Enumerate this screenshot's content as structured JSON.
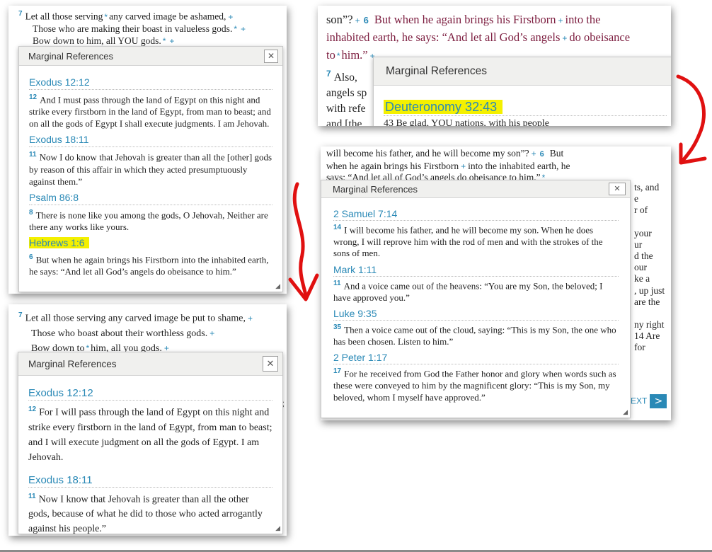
{
  "shot1": {
    "verse7_num": "7",
    "verse7_l1": "Let all those serving",
    "verse7_l1b": "any carved image be ashamed,",
    "verse7_l2": "Those who are making their boast in valueless gods.",
    "verse7_l3": "Bow down to him, all YOU gods.",
    "popup": {
      "title": "Marginal References",
      "close": "✕",
      "refs": [
        {
          "ref": "Exodus 12:12",
          "num": "12",
          "text": "And I must pass through the land of Egypt on this night and strike every firstborn in the land of Egypt, from man to beast; and on all the gods of Egypt I shall execute judgments. I am Jehovah."
        },
        {
          "ref": "Exodus 18:11",
          "num": "11",
          "text": "Now I do know that Jehovah is greater than all the [other] gods by reason of this affair in which they acted presumptuously against them.”"
        },
        {
          "ref": "Psalm 86:8",
          "num": "8",
          "text": "There is none like you among the gods, O Jehovah, Neither are there any works like yours."
        },
        {
          "ref": "Hebrews 1:6",
          "num": "6",
          "text": "But when he again brings his Firstborn into the inhabited earth, he says: “And let all God’s angels do obeisance to him.”"
        }
      ]
    }
  },
  "shot2": {
    "l1a": "son”?",
    "l1num": "6",
    "l1b": "But when he again brings his Firstborn",
    "l1c": "into the",
    "l2a": "inhabited earth, he says: “And let all God’s angels",
    "l2b": "do obeisance",
    "l3a": "to",
    "l3b": "him.”",
    "l4num": "7",
    "l4": "Also,",
    "l5": "angels sp",
    "l6": "with refe",
    "l7": "and [the",
    "popup": {
      "title": "Marginal References",
      "ref": "Deuteronomy 32:43",
      "partial": "43 Be glad, YOU nations, with his people"
    }
  },
  "shot3": {
    "l1a": "will become his father, and he will become my son”?",
    "l1num": "6",
    "l1b": "But",
    "l2a": "when he again brings his Firstborn",
    "l2b": "into the inhabited earth, he",
    "l3": "says: “And let all of God’s angels do obeisance to him.”",
    "side": [
      "ts, and",
      "e",
      "r of",
      "",
      "your",
      "ur",
      "d the",
      "our",
      "ke a",
      ", up just",
      "are the",
      "",
      "ny right",
      "14  Are",
      "for"
    ],
    "next_label": "EXT",
    "next_arrow": ">",
    "popup": {
      "title": "Marginal References",
      "close": "✕",
      "refs": [
        {
          "ref": "2 Samuel 7:14",
          "num": "14",
          "text": "I will become his father, and he will become my son. When he does wrong, I will reprove him with the rod of men and with the strokes of the sons of men."
        },
        {
          "ref": "Mark 1:11",
          "num": "11",
          "text": "And a voice came out of the heavens: “You are my Son, the beloved; I have approved you.”"
        },
        {
          "ref": "Luke 9:35",
          "num": "35",
          "text": "Then a voice came out of the cloud, saying: “This is my Son, the one who has been chosen. Listen to him.”"
        },
        {
          "ref": "2 Peter 1:17",
          "num": "17",
          "text": "For he received from God the Father honor and glory when words such as these were conveyed to him by the magnificent glory: “This is my Son, my beloved, whom I myself have approved.”"
        }
      ]
    }
  },
  "shot4": {
    "verse7_num": "7",
    "l1": "Let all those serving any carved image be put to shame,",
    "l2": "Those who boast about their worthless gods.",
    "l3a": "Bow down to",
    "l3b": "him, all you gods.",
    "semicolon": ";",
    "popup": {
      "title": "Marginal References",
      "close": "✕",
      "refs": [
        {
          "ref": "Exodus 12:12",
          "num": "12",
          "text": "For I will pass through the land of Egypt on this night and strike every firstborn in the land of Egypt, from man to beast; and I will execute judgment on all the gods of Egypt. I am Jehovah."
        },
        {
          "ref": "Exodus 18:11",
          "num": "11",
          "text": "Now I know that Jehovah is greater than all the other gods, because of what he did to those who acted arrogantly against his people.”"
        }
      ]
    }
  },
  "colors": {
    "accent": "#2a89b6",
    "highlight": "#f4f000",
    "arrow": "#e01010",
    "maroon": "#7c1d3f"
  },
  "icons": {
    "plus": "+",
    "star": "*",
    "resize": "◢"
  }
}
